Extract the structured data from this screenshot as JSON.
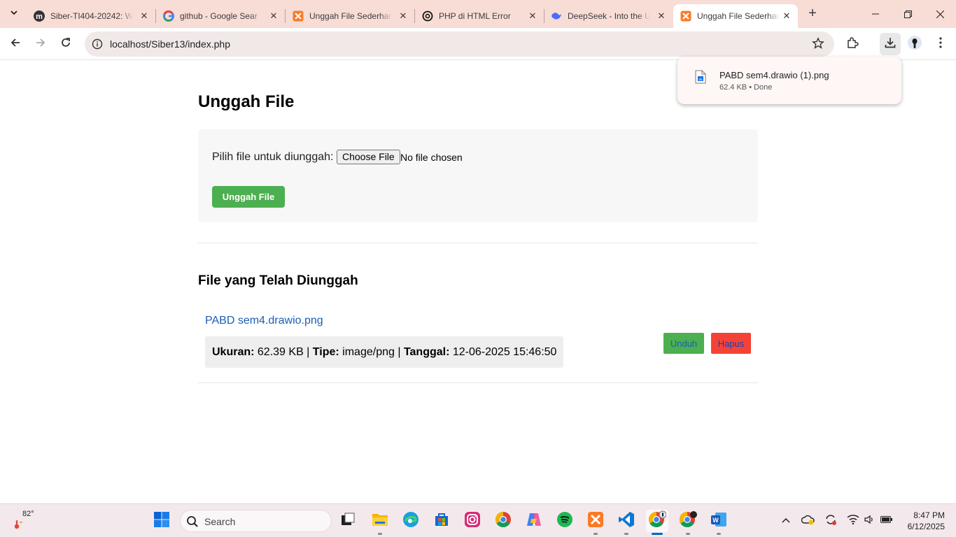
{
  "browser": {
    "tabs": [
      {
        "title": "Siber-TI404-20242: W",
        "icon": "moodle-icon",
        "active": false
      },
      {
        "title": "github - Google Sear",
        "icon": "google-icon",
        "active": false
      },
      {
        "title": "Unggah File Sederhan",
        "icon": "xampp-icon",
        "active": false
      },
      {
        "title": "PHP di HTML Error",
        "icon": "chatgpt-icon",
        "active": false
      },
      {
        "title": "DeepSeek - Into the U",
        "icon": "deepseek-icon",
        "active": false
      },
      {
        "title": "Unggah File Sederhan",
        "icon": "xampp-icon",
        "active": true
      }
    ],
    "url": "localhost/Siber13/index.php",
    "download": {
      "filename": "PABD sem4.drawio (1).png",
      "meta": "62.4 KB • Done"
    }
  },
  "page": {
    "title": "Unggah File",
    "upload_label": "Pilih file untuk diunggah:",
    "choose_button": "Choose File",
    "no_file": "No file chosen",
    "upload_button": "Unggah File",
    "list_title": "File yang Telah Diunggah",
    "files": [
      {
        "name": "PABD sem4.drawio.png",
        "size_label": "Ukuran:",
        "size": "62.39 KB",
        "type_label": "Tipe:",
        "type": "image/png",
        "date_label": "Tanggal:",
        "date": "12-06-2025 15:46:50",
        "download_button": "Unduh",
        "delete_button": "Hapus"
      }
    ]
  },
  "taskbar": {
    "weather_temp": "82°",
    "search_placeholder": "Search",
    "time": "8:47 PM",
    "date": "6/12/2025"
  },
  "colors": {
    "accent_green": "#4caf50",
    "danger_red": "#f44336",
    "link_blue": "#1a5fb4",
    "tabstrip": "#f8dcd6"
  }
}
